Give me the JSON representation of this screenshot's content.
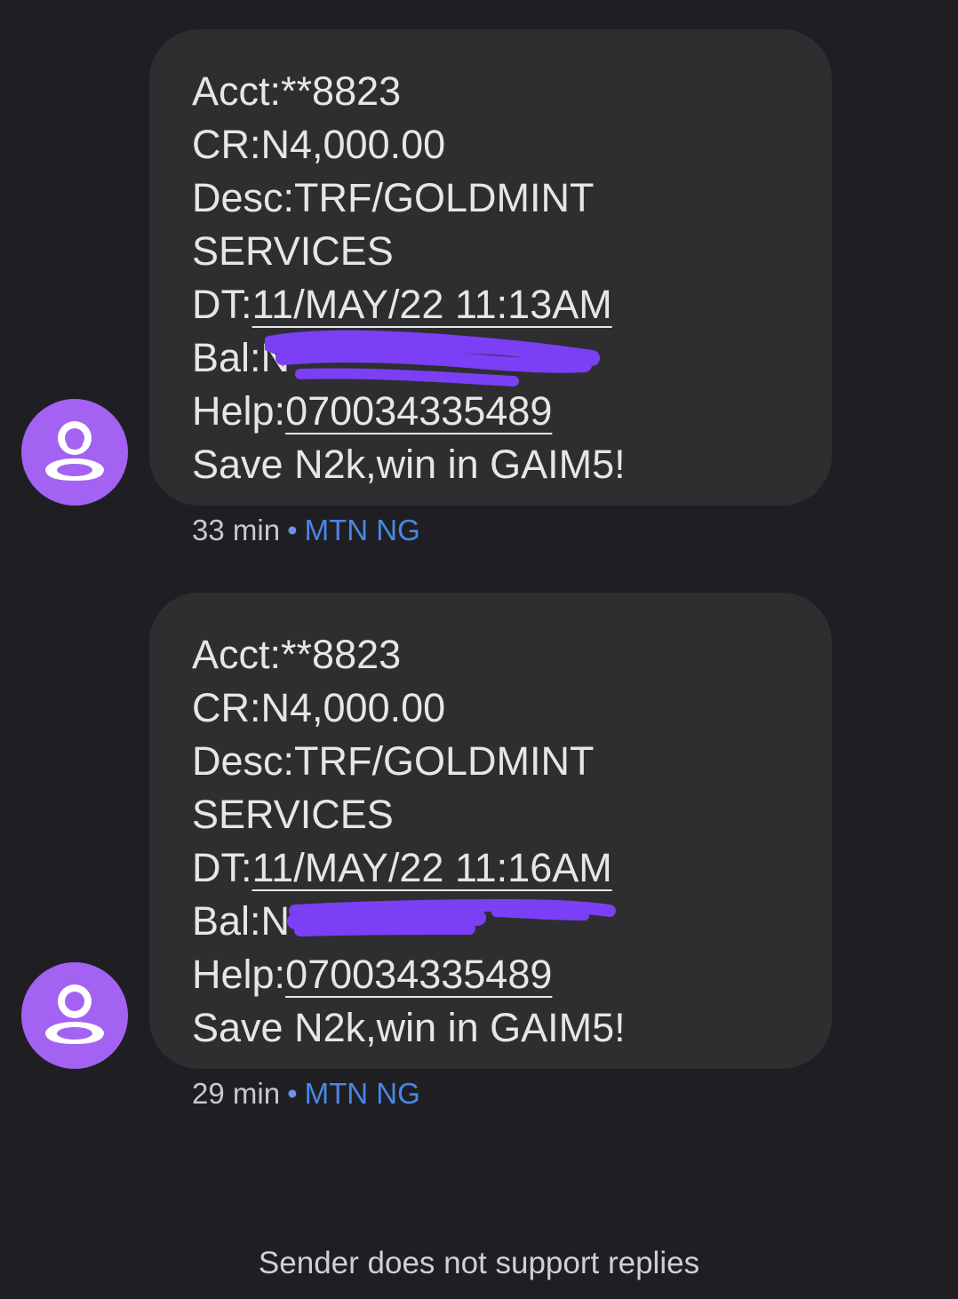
{
  "messages": [
    {
      "lines": {
        "acct": "Acct:**8823",
        "cr": "CR:N4,000.00",
        "desc": "Desc:TRF/GOLDMINT",
        "services": "SERVICES",
        "dt_prefix": "DT:",
        "dt_value": "11/MAY/22 11:13AM",
        "bal_prefix": "Bal:N",
        "help_prefix": "Help:",
        "help_value": "07003433548​9",
        "promo": "Save N2k,win in GAIM5!"
      },
      "time": "33 min",
      "separator": "•",
      "sender": "MTN NG",
      "balance_redacted": true
    },
    {
      "lines": {
        "acct": "Acct:**8823",
        "cr": "CR:N4,000.00",
        "desc": "Desc:TRF/GOLDMINT",
        "services": "SERVICES",
        "dt_prefix": "DT:",
        "dt_value": "11/MAY/22 11:16AM",
        "bal_prefix": "Bal:N",
        "help_prefix": "Help:",
        "help_value": "07003433548​9",
        "promo": "Save N2k,win in GAIM5!"
      },
      "time": "29 min",
      "separator": "•",
      "sender": "MTN NG",
      "balance_redacted": true
    }
  ],
  "footer": {
    "text": "Sender does not support replies"
  },
  "colors": {
    "background": "#1f1f23",
    "bubble": "#2e2e30",
    "avatar": "#a462f2",
    "redaction": "#7b3ff5",
    "link": "#4a86e8"
  },
  "icons": {
    "avatar": "person-icon"
  }
}
